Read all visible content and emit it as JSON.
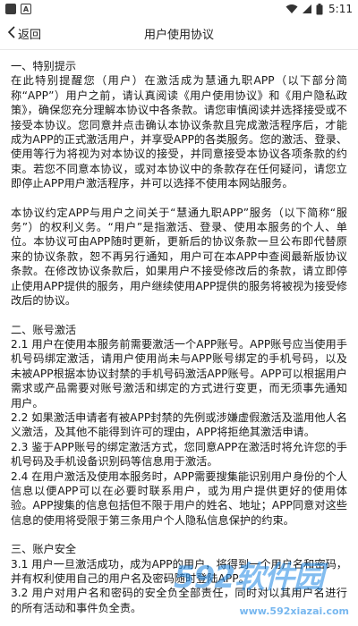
{
  "status_bar": {
    "time": "5:11",
    "left_icons": [
      "notification-square-icon",
      "a-letter-square-icon"
    ],
    "right_icons": [
      "wifi-icon",
      "signal-icon",
      "battery-icon"
    ]
  },
  "header": {
    "back_label": "返回",
    "title": "用户使用协议"
  },
  "content": {
    "s1_title": "一、特别提示",
    "s1_p1": "在此特别提醒您（用户）在激活成为慧通九职APP（以下部分简称“APP”）用户之前，请认真阅读《用户使用协议》和《用户隐私政策》，确保您充分理解本协议中各条款。请您审慎阅读并选择接受或不接受本协议。您同意并点击确认本协议条款且完成激活程序后，才能成为APP的正式激活用户，并享受APP的各类服务。您的激活、登录、使用等行为将视为对本协议的接受，并同意接受本协议各项条款的约束。若您不同意本协议，或对本协议中的条款存在任何疑问，请您立即停止APP用户激活程序，并可以选择不使用本网站服务。",
    "s1_p2": "本协议约定APP与用户之间关于“慧通九职APP”服务（以下简称“服务”）的权利义务。“用户”是指激活、登录、使用本服务的个人、单位。本协议可由APP随时更新，更新后的协议条款一旦公布即代替原来的协议条款，恕不再另行通知，用户可在本APP中查阅最新版协议条款。在修改协议条款后，如果用户不接受修改后的条款，请立即停止使用APP提供的服务，用户继续使用APP提供的服务将被视为接受修改后的协议。",
    "s2_title": "二、账号激活",
    "s2_p1": "2.1 用户在使用本服务前需要激活一个APP账号。APP账号应当使用手机号码绑定激活，请用户使用尚未与APP账号绑定的手机号码，以及未被APP根据本协议封禁的手机号码激活APP账号。APP可以根据用户需求或产品需要对账号激活和绑定的方式进行变更，而无须事先通知用户。",
    "s2_p2": "2.2 如果激活申请者有被APP封禁的先例或涉嫌虚假激活及滥用他人名义激活，及其他不能得到许可的理由，APP将拒绝其激活申请。",
    "s2_p3": "2.3 鉴于APP账号的绑定激活方式，您同意APP在激活时将允许您的手机号码及手机设备识别码等信息用于激活。",
    "s2_p4": "2.4 在用户激活及使用本服务时，APP需要搜集能识别用户身份的个人信息以便APP可以在必要时联系用户，或为用户提供更好的使用体验。APP搜集的信息包括但不限于用户的姓名、地址；APP同意对这些信息的使用将受限于第三条用户个人隐私信息保护的约束。",
    "s3_title": "三、账户安全",
    "s3_p1": "3.1 用户一旦激活成功，成为APP的用户，将得到一个用户名和密码，并有权利使用自己的用户名及密码随时登陆APP。",
    "s3_p2": "3.2 用户对用户名和密码的安全负全部责任，同时对以其用户名进行的所有活动和事件负全责。"
  },
  "watermark": {
    "brand": "592软件园",
    "url": "www.592xiazai.com"
  }
}
